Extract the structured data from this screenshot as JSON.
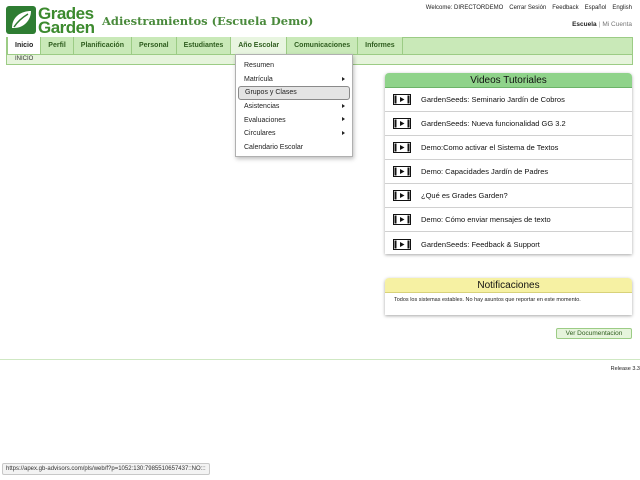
{
  "brand": {
    "logo_line1": "Grades",
    "logo_line2": "Garden",
    "app_title": "Adiestramientos (Escuela Demo)"
  },
  "top_links": {
    "welcome": "Welcome: DIRECTORDEMO",
    "logout": "Cerrar Sesión",
    "feedback": "Feedback",
    "espanol": "Español",
    "english": "English"
  },
  "account_nav": {
    "escuela": "Escuela",
    "separator": "|",
    "mi_cuenta": "Mi Cuenta"
  },
  "tabs": [
    {
      "label": "Inicio",
      "active": true
    },
    {
      "label": "Perfil"
    },
    {
      "label": "Planificación"
    },
    {
      "label": "Personal"
    },
    {
      "label": "Estudiantes"
    },
    {
      "label": "Año Escolar",
      "open": true
    },
    {
      "label": "Comunicaciones"
    },
    {
      "label": "Informes"
    }
  ],
  "breadcrumb": "INICIO",
  "dropdown": {
    "items": [
      {
        "label": "Resumen",
        "submenu": false
      },
      {
        "label": "Matrícula",
        "submenu": true
      },
      {
        "label": "Grupos y Clases",
        "submenu": false,
        "highlighted": true
      },
      {
        "label": "Asistencias",
        "submenu": true
      },
      {
        "label": "Evaluaciones",
        "submenu": true
      },
      {
        "label": "Circulares",
        "submenu": true
      },
      {
        "label": "Calendario Escolar",
        "submenu": false
      }
    ]
  },
  "videos": {
    "title": "Videos Tutoriales",
    "items": [
      "GardenSeeds: Seminario Jardín de Cobros",
      "GardenSeeds: Nueva funcionalidad GG 3.2",
      "Demo:Como activar el Sistema de Textos",
      "Demo: Capacidades Jardín de Padres",
      "¿Qué es Grades Garden?",
      "Demo: Cómo enviar mensajes de texto",
      "GardenSeeds: Feedback & Support"
    ]
  },
  "notifications": {
    "title": "Notificaciones",
    "text": "Todos los sistemas estables. No hay asuntos que reportar en este momento."
  },
  "doc_button": "Ver Documentacion",
  "release": "Release 3.3",
  "status_url": "https://apex.gb-advisors.com/pls/web/f?p=1052:130:7985510657437::NO:::",
  "colors": {
    "brand_green": "#3c8a2e",
    "nav_green": "#c9e9b8",
    "videos_header": "#8fd38a",
    "notifications_header": "#f6f1a3"
  },
  "icons": {
    "logo": "leaf-logo-icon",
    "video": "video-film-icon",
    "submenu": "submenu-arrow-icon"
  }
}
